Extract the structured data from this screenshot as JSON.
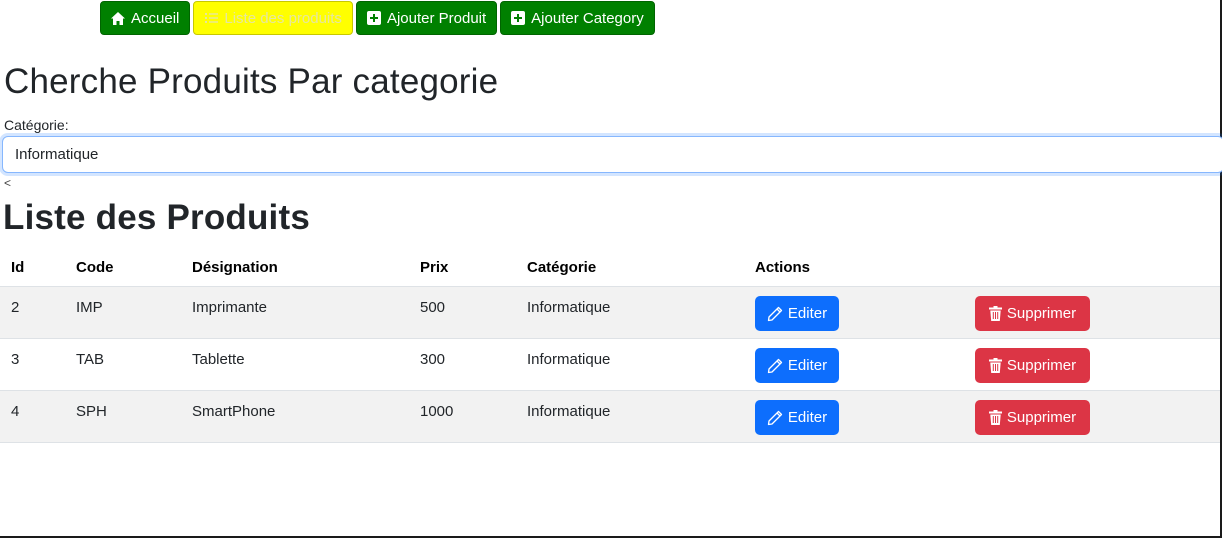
{
  "nav": {
    "items": [
      {
        "label": "Accueil",
        "icon": "home-icon"
      },
      {
        "label": "Liste des produits",
        "icon": "list-icon"
      },
      {
        "label": "Ajouter Produit",
        "icon": "plus-square-icon"
      },
      {
        "label": "Ajouter Category",
        "icon": "plus-square-icon"
      }
    ],
    "colors": {
      "button": "#008000",
      "active": "#ffff00"
    }
  },
  "search": {
    "title": "Cherche Produits Par categorie",
    "category_label": "Catégorie:",
    "selected_category": "Informatique",
    "stray_text": "<"
  },
  "products": {
    "title": "Liste des Produits",
    "columns": [
      "Id",
      "Code",
      "Désignation",
      "Prix",
      "Catégorie",
      "Actions"
    ],
    "rows": [
      {
        "id": "2",
        "code": "IMP",
        "designation": "Imprimante",
        "prix": "500",
        "categorie": "Informatique"
      },
      {
        "id": "3",
        "code": "TAB",
        "designation": "Tablette",
        "prix": "300",
        "categorie": "Informatique"
      },
      {
        "id": "4",
        "code": "SPH",
        "designation": "SmartPhone",
        "prix": "1000",
        "categorie": "Informatique"
      }
    ],
    "edit_label": "Editer",
    "delete_label": "Supprimer",
    "colors": {
      "edit": "#0d6efd",
      "delete": "#dc3545"
    }
  }
}
